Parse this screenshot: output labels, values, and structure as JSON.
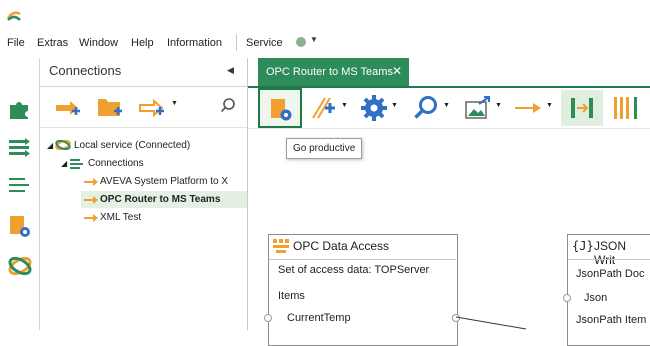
{
  "menubar": {
    "items": [
      "File",
      "Extras",
      "Window",
      "Help",
      "Information",
      "Service"
    ]
  },
  "connections_panel": {
    "title": "Connections",
    "tree": {
      "root": "Local service (Connected)",
      "group": "Connections",
      "items": [
        "AVEVA System Platform to X",
        "OPC Router to MS Teams",
        "XML Test"
      ],
      "selected_index": 1
    }
  },
  "tabs": [
    {
      "label": "OPC Router to MS Teams",
      "close": "✕"
    }
  ],
  "toolbar": {
    "tooltip": "Go productive",
    "buttons": [
      "go-productive",
      "plugin-add",
      "settings",
      "search",
      "image-export",
      "arrow-connect",
      "frame-select",
      "bar-align"
    ]
  },
  "nodes": {
    "opc": {
      "title": "OPC Data Access",
      "rows": [
        "Set of access data: TOPServer",
        "Items",
        "CurrentTemp"
      ]
    },
    "json": {
      "title": "JSON Writ",
      "rows": [
        "JsonPath Doc",
        "Json",
        "JsonPath Item"
      ]
    }
  },
  "colors": {
    "accent": "#2e8b5a",
    "orange": "#f0a030",
    "blue": "#2f6fc6"
  }
}
